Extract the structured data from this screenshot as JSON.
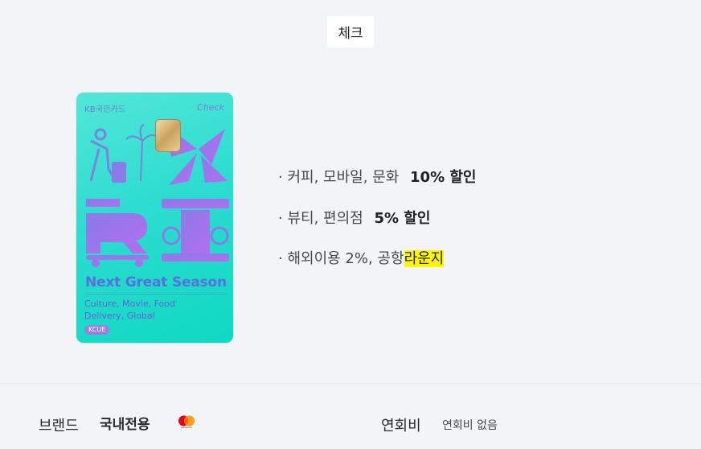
{
  "card_type": "체크",
  "card": {
    "issuer": "KB국민카드",
    "kind": "Check",
    "slogan": "Next Great Season",
    "tags_line1": "Culture, Movie, Food",
    "tags_line2": "Delivery, Global",
    "pill": "KCUE"
  },
  "benefits": [
    {
      "bullet": "·",
      "text": "커피, 모바일, 문화",
      "value": "10%  할인"
    },
    {
      "bullet": "·",
      "text": "뷰티, 편의점",
      "value": "5%  할인"
    },
    {
      "bullet": "·",
      "text": "해외이용 2%, 공항",
      "highlight": "라운지"
    }
  ],
  "footer": {
    "brand_label": "브랜드",
    "brand_value": "국내전용",
    "brand_icon": "mastercard-icon",
    "fee_label": "연회비",
    "fee_value": "연회비 없음"
  },
  "colors": {
    "background": "#f2f4f8",
    "card_gradient_start": "#52e7d8",
    "card_gradient_end": "#0ed9c2",
    "card_accent": "#5a6ee0",
    "highlight": "#fff600"
  }
}
